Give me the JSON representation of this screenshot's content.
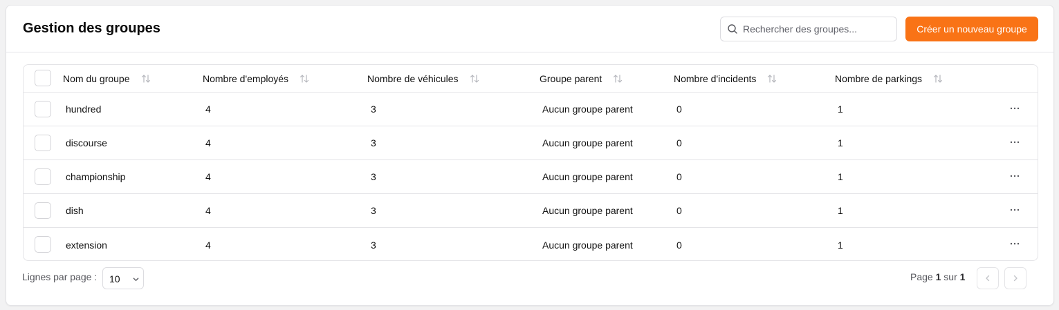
{
  "header": {
    "title": "Gestion des groupes",
    "search_placeholder": "Rechercher des groupes...",
    "search_value": "",
    "create_button_label": "Créer un nouveau groupe",
    "accent_color": "#f97316"
  },
  "table": {
    "columns": [
      "Nom du groupe",
      "Nombre d'employés",
      "Nombre de véhicules",
      "Groupe parent",
      "Nombre d'incidents",
      "Nombre de parkings"
    ],
    "rows": [
      {
        "name": "hundred",
        "employees": "4",
        "vehicles": "3",
        "parent": "Aucun groupe parent",
        "incidents": "0",
        "parkings": "1"
      },
      {
        "name": "discourse",
        "employees": "4",
        "vehicles": "3",
        "parent": "Aucun groupe parent",
        "incidents": "0",
        "parkings": "1"
      },
      {
        "name": "championship",
        "employees": "4",
        "vehicles": "3",
        "parent": "Aucun groupe parent",
        "incidents": "0",
        "parkings": "1"
      },
      {
        "name": "dish",
        "employees": "4",
        "vehicles": "3",
        "parent": "Aucun groupe parent",
        "incidents": "0",
        "parkings": "1"
      },
      {
        "name": "extension",
        "employees": "4",
        "vehicles": "3",
        "parent": "Aucun groupe parent",
        "incidents": "0",
        "parkings": "1"
      }
    ]
  },
  "footer": {
    "rows_per_page_label": "Lignes par page :",
    "rows_per_page_value": "10",
    "page_prefix": "Page",
    "current_page": "1",
    "page_sep": "sur",
    "total_pages": "1"
  },
  "icons": {
    "search": "search-icon",
    "sort": "sort-icon",
    "more": "more-horizontal-icon",
    "chevron_down": "chevron-down-icon",
    "prev": "chevron-left-icon",
    "next": "chevron-right-icon"
  }
}
